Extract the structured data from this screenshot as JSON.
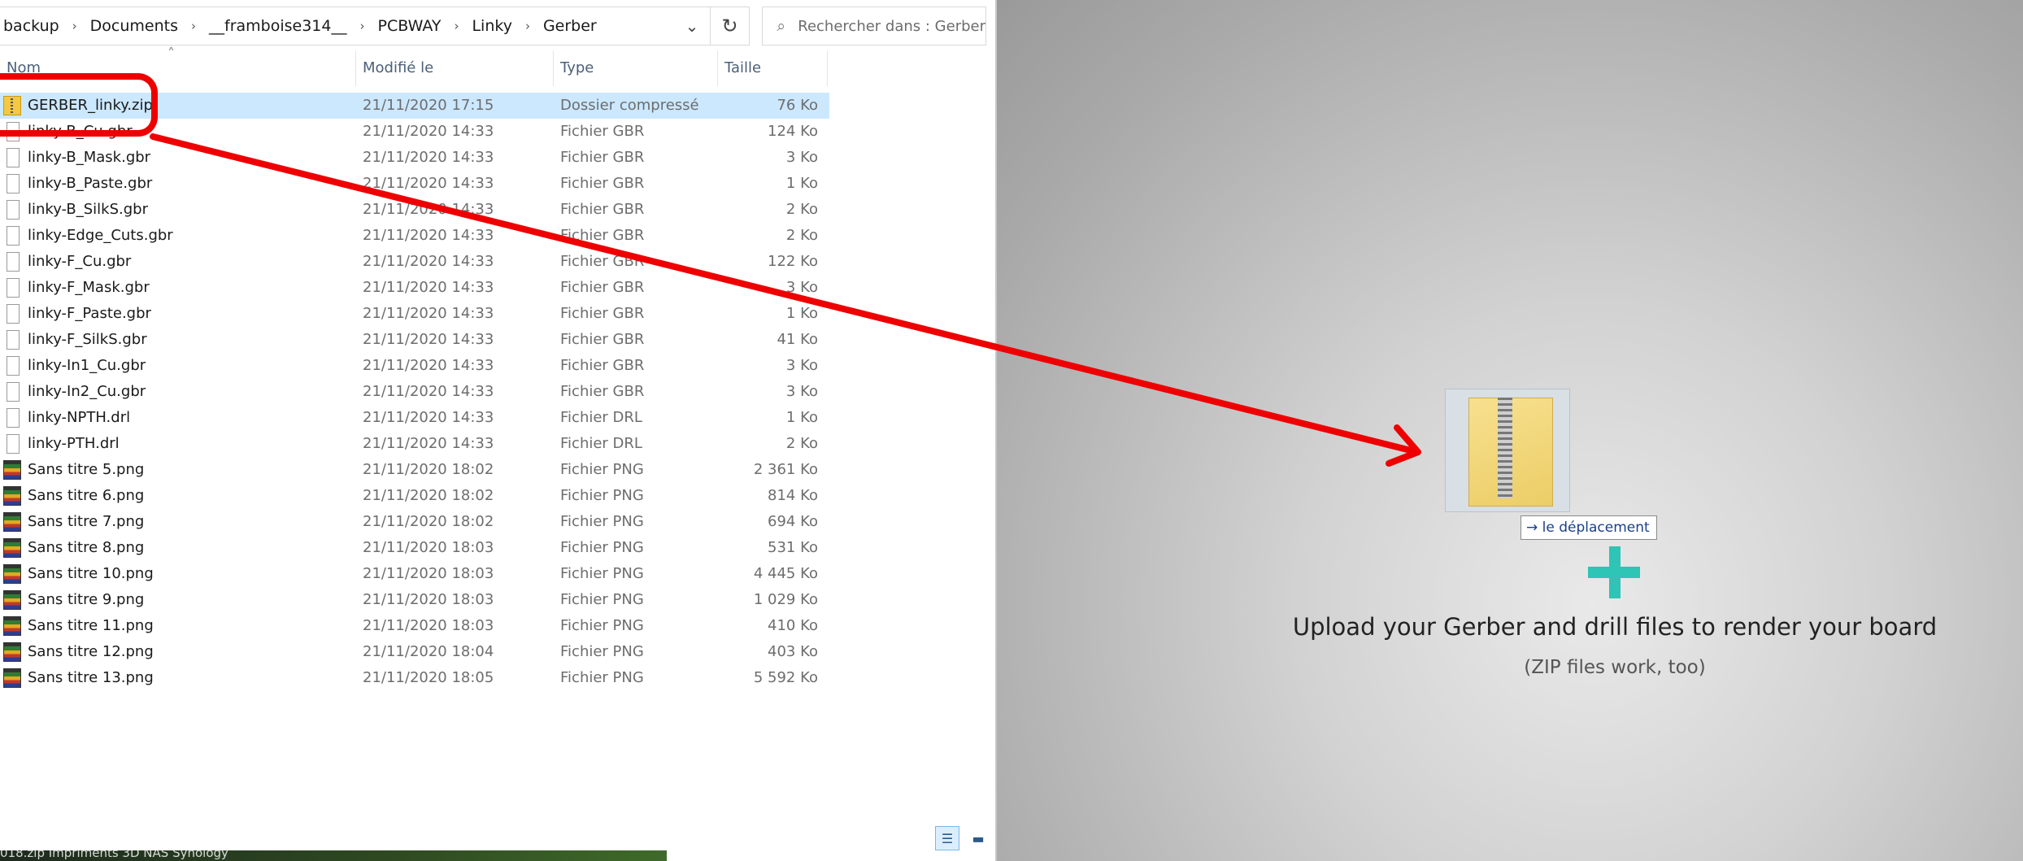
{
  "explorer": {
    "breadcrumb": [
      "backup",
      "Documents",
      "__framboise314__",
      "PCBWAY",
      "Linky",
      "Gerber"
    ],
    "search_placeholder": "Rechercher dans : Gerber",
    "columns": {
      "name": "Nom",
      "modified": "Modifié le",
      "type": "Type",
      "size": "Taille"
    },
    "files": [
      {
        "name": "GERBER_linky.zip",
        "modified": "21/11/2020 17:15",
        "type": "Dossier compressé",
        "size": "76 Ko",
        "icon": "zip-icon",
        "selected": true
      },
      {
        "name": "linky-B_Cu.gbr",
        "modified": "21/11/2020 14:33",
        "type": "Fichier GBR",
        "size": "124 Ko",
        "icon": "file-icon"
      },
      {
        "name": "linky-B_Mask.gbr",
        "modified": "21/11/2020 14:33",
        "type": "Fichier GBR",
        "size": "3 Ko",
        "icon": "file-icon"
      },
      {
        "name": "linky-B_Paste.gbr",
        "modified": "21/11/2020 14:33",
        "type": "Fichier GBR",
        "size": "1 Ko",
        "icon": "file-icon"
      },
      {
        "name": "linky-B_SilkS.gbr",
        "modified": "21/11/2020 14:33",
        "type": "Fichier GBR",
        "size": "2 Ko",
        "icon": "file-icon"
      },
      {
        "name": "linky-Edge_Cuts.gbr",
        "modified": "21/11/2020 14:33",
        "type": "Fichier GBR",
        "size": "2 Ko",
        "icon": "file-icon"
      },
      {
        "name": "linky-F_Cu.gbr",
        "modified": "21/11/2020 14:33",
        "type": "Fichier GBR",
        "size": "122 Ko",
        "icon": "file-icon"
      },
      {
        "name": "linky-F_Mask.gbr",
        "modified": "21/11/2020 14:33",
        "type": "Fichier GBR",
        "size": "3 Ko",
        "icon": "file-icon"
      },
      {
        "name": "linky-F_Paste.gbr",
        "modified": "21/11/2020 14:33",
        "type": "Fichier GBR",
        "size": "1 Ko",
        "icon": "file-icon"
      },
      {
        "name": "linky-F_SilkS.gbr",
        "modified": "21/11/2020 14:33",
        "type": "Fichier GBR",
        "size": "41 Ko",
        "icon": "file-icon"
      },
      {
        "name": "linky-In1_Cu.gbr",
        "modified": "21/11/2020 14:33",
        "type": "Fichier GBR",
        "size": "3 Ko",
        "icon": "file-icon"
      },
      {
        "name": "linky-In2_Cu.gbr",
        "modified": "21/11/2020 14:33",
        "type": "Fichier GBR",
        "size": "3 Ko",
        "icon": "file-icon"
      },
      {
        "name": "linky-NPTH.drl",
        "modified": "21/11/2020 14:33",
        "type": "Fichier DRL",
        "size": "1 Ko",
        "icon": "file-icon"
      },
      {
        "name": "linky-PTH.drl",
        "modified": "21/11/2020 14:33",
        "type": "Fichier DRL",
        "size": "2 Ko",
        "icon": "file-icon"
      },
      {
        "name": "Sans titre 5.png",
        "modified": "21/11/2020 18:02",
        "type": "Fichier PNG",
        "size": "2 361 Ko",
        "icon": "image-icon"
      },
      {
        "name": "Sans titre 6.png",
        "modified": "21/11/2020 18:02",
        "type": "Fichier PNG",
        "size": "814 Ko",
        "icon": "image-icon"
      },
      {
        "name": "Sans titre 7.png",
        "modified": "21/11/2020 18:02",
        "type": "Fichier PNG",
        "size": "694 Ko",
        "icon": "image-icon"
      },
      {
        "name": "Sans titre 8.png",
        "modified": "21/11/2020 18:03",
        "type": "Fichier PNG",
        "size": "531 Ko",
        "icon": "image-icon"
      },
      {
        "name": "Sans titre 10.png",
        "modified": "21/11/2020 18:03",
        "type": "Fichier PNG",
        "size": "4 445 Ko",
        "icon": "image-icon"
      },
      {
        "name": "Sans titre 9.png",
        "modified": "21/11/2020 18:03",
        "type": "Fichier PNG",
        "size": "1 029 Ko",
        "icon": "image-icon"
      },
      {
        "name": "Sans titre 11.png",
        "modified": "21/11/2020 18:03",
        "type": "Fichier PNG",
        "size": "410 Ko",
        "icon": "image-icon"
      },
      {
        "name": "Sans titre 12.png",
        "modified": "21/11/2020 18:04",
        "type": "Fichier PNG",
        "size": "403 Ko",
        "icon": "image-icon"
      },
      {
        "name": "Sans titre 13.png",
        "modified": "21/11/2020 18:05",
        "type": "Fichier PNG",
        "size": "5 592 Ko",
        "icon": "image-icon"
      }
    ],
    "taskbar_text": "018.zip    Impriments 3D     NAS Synology"
  },
  "viewer": {
    "drag_tooltip": "le déplacement",
    "upload_title": "Upload your Gerber and drill files to render your board",
    "upload_subtitle": "(ZIP files work, too)",
    "accent_color": "#2ec4b6"
  },
  "annotation": {
    "color": "#ee0000"
  }
}
